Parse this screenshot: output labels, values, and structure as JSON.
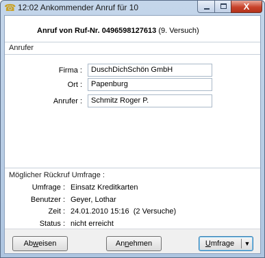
{
  "window": {
    "title": "12:02 Ankommender Anruf für 10",
    "icon": "phone-icon",
    "close_glyph": "X"
  },
  "heading": {
    "prefix": "Anruf von Ruf-Nr. 0496598127613",
    "suffix": "(9. Versuch)"
  },
  "anrufer_section": {
    "label": "Anrufer",
    "fields": {
      "firma_label": "Firma :",
      "firma_value": "DuschDichSchön GmbH",
      "ort_label": "Ort :",
      "ort_value": "Papenburg",
      "anrufer_label": "Anrufer :",
      "anrufer_value": "Schmitz Roger P."
    }
  },
  "rueckruf_section": {
    "label": "Möglicher Rückruf Umfrage :",
    "rows": [
      {
        "label": "Umfrage :",
        "value": "Einsatz Kreditkarten"
      },
      {
        "label": "Benutzer :",
        "value": "Geyer, Lothar"
      },
      {
        "label": "Zeit :",
        "value": "24.01.2010 15:16  (2 Versuche)"
      },
      {
        "label": "Status :",
        "value": "nicht erreicht"
      }
    ]
  },
  "buttons": {
    "abweisen_pre": "Ab",
    "abweisen_acc": "w",
    "abweisen_post": "eisen",
    "annehmen_pre": "An",
    "annehmen_acc": "n",
    "annehmen_post": "ehmen",
    "umfrage_acc": "U",
    "umfrage_post": "mfrage",
    "umfrage_arrow": "▼"
  }
}
